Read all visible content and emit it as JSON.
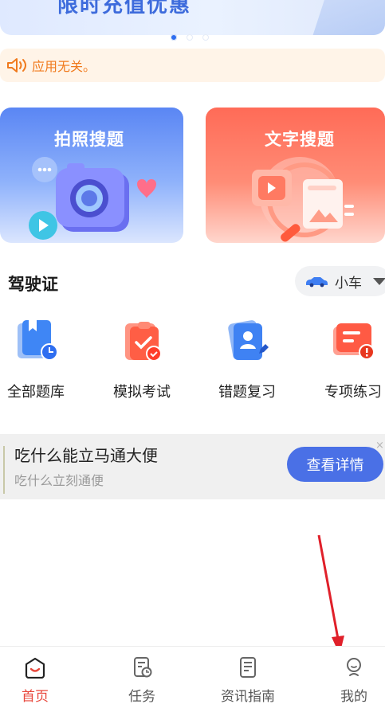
{
  "banner": {
    "title": "限时充值优惠",
    "dots": 3,
    "active_dot": 0
  },
  "notice": {
    "text": "应用无关。"
  },
  "features": [
    {
      "title": "拍照搜题"
    },
    {
      "title": "文字搜题"
    }
  ],
  "section": {
    "title": "驾驶证"
  },
  "vehicle_select": {
    "value": "小车"
  },
  "tools": [
    {
      "label": "全部题库",
      "icon": "question-bank-icon"
    },
    {
      "label": "模拟考试",
      "icon": "mock-exam-icon"
    },
    {
      "label": "错题复习",
      "icon": "wrong-question-icon"
    },
    {
      "label": "专项练习",
      "icon": "special-practice-icon"
    }
  ],
  "ad": {
    "title": "吃什么能立马通大便",
    "subtitle": "吃什么立刻通便",
    "button": "查看详情",
    "close": "×"
  },
  "tabbar": {
    "items": [
      {
        "label": "首页",
        "icon": "home-icon",
        "active": true
      },
      {
        "label": "任务",
        "icon": "task-icon",
        "active": false
      },
      {
        "label": "资讯指南",
        "icon": "news-icon",
        "active": false
      },
      {
        "label": "我的",
        "icon": "profile-icon",
        "active": false
      }
    ]
  },
  "colors": {
    "accent_blue": "#2f6ef0",
    "notice_orange": "#f07a1d",
    "active_tab_red": "#e8483c",
    "annotation_arrow": "#e0202a"
  }
}
